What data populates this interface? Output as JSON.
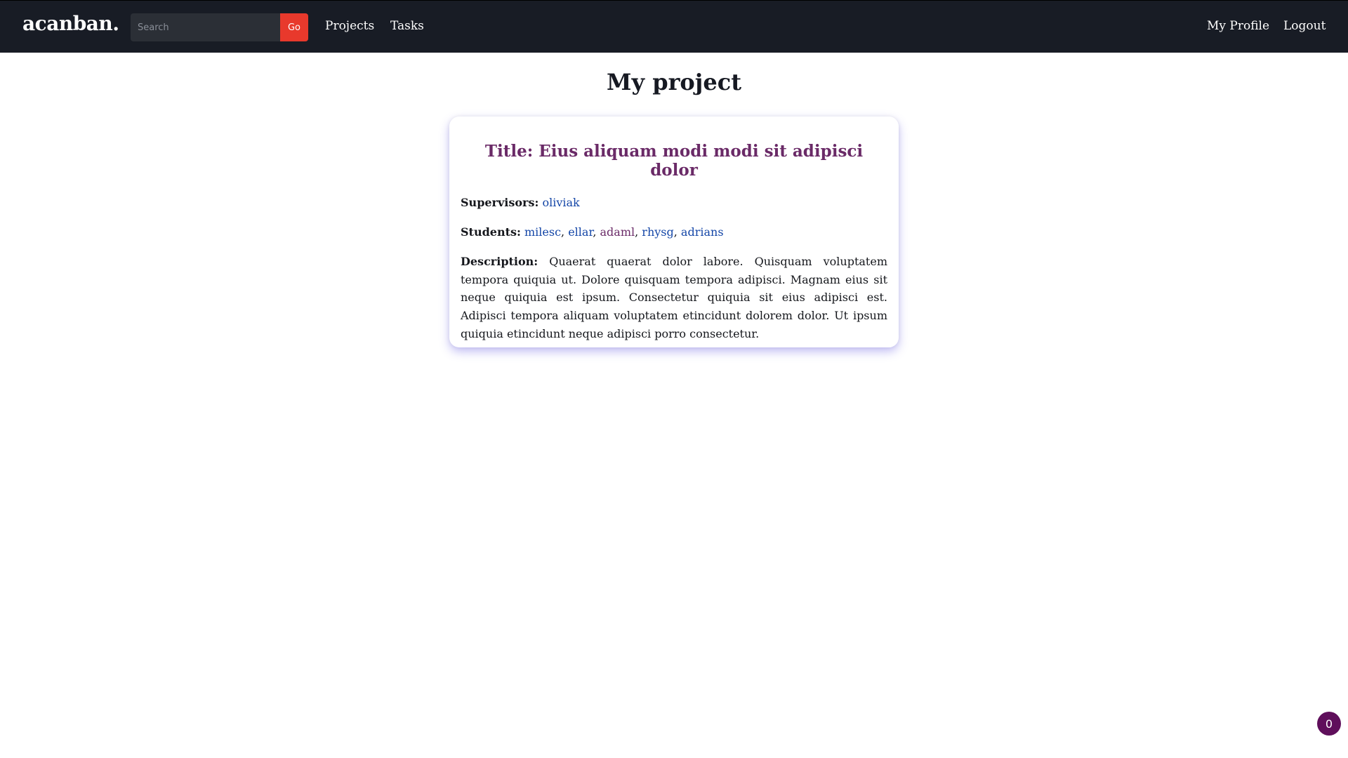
{
  "navbar": {
    "brand": "acanban.",
    "search": {
      "placeholder": "Search",
      "value": "",
      "button_label": "Go"
    },
    "links": {
      "projects": "Projects",
      "tasks": "Tasks",
      "profile": "My Profile",
      "logout": "Logout"
    }
  },
  "page": {
    "title": "My project"
  },
  "project": {
    "title": "Title: Eius aliquam modi modi sit adipisci dolor",
    "supervisors_label": "Supervisors:",
    "supervisors": [
      "oliviak"
    ],
    "students_label": "Students:",
    "students": [
      "milesc",
      "ellar",
      "adaml",
      "rhysg",
      "adrians"
    ],
    "description_label": "Description:",
    "description": "Quaerat quaerat dolor labore. Quisquam voluptatem tempora quiquia ut. Dolore quisquam tempora adipisci. Magnam eius sit neque quiquia est ipsum. Consectetur quiquia sit eius adipisci est. Adipisci tempora aliquam voluptatem etincidunt dolorem dolor. Ut ipsum quiquia etincidunt neque adipisci porro consectetur."
  },
  "badge": {
    "count": "0"
  },
  "colors": {
    "navbar_bg": "#181c25",
    "go_button": "#e8392c",
    "card_title": "#6a2a67",
    "link": "#1446a7",
    "badge_bg": "#5f0f5b"
  }
}
